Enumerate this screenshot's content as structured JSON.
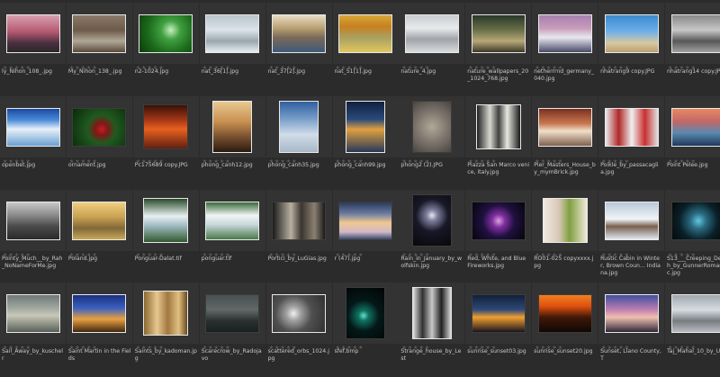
{
  "browser": {
    "star_glyph": "★★★★★",
    "items": [
      {
        "name": "ly_Nihon_108_.jpg",
        "bg": "linear-gradient(180deg,#d8a0b0 0%,#b45870 45%,#4a3040 75%,#2a2828 100%)",
        "shape": "wide",
        "dark": false
      },
      {
        "name": "My_Nihon_138_.jpg",
        "bg": "linear-gradient(180deg,#8a7a6a 0%,#6d5a48 40%,#b0a898 70%,#5a4a3a 100%)",
        "shape": "wide",
        "dark": false
      },
      {
        "name": "n2-1024.jpg",
        "bg": "radial-gradient(circle at 60% 40%,#c8f0c0 0%,#40a040 25%,#1c6a1c 60%,#0c3a0c 100%)",
        "shape": "wide",
        "dark": false
      },
      {
        "name": "nat_36[1].jpg",
        "bg": "linear-gradient(180deg,#b8c4cc 0%,#dde4ea 40%,#9aa6ae 70%,#e8eef2 100%)",
        "shape": "wide",
        "dark": false
      },
      {
        "name": "nat_37[2].jpg",
        "bg": "linear-gradient(180deg,#e8dcc4 0%,#b8a070 35%,#7a6a58 60%,#3f5a7a 100%)",
        "shape": "wide",
        "dark": false
      },
      {
        "name": "nat_51[1].jpg",
        "bg": "linear-gradient(180deg,#d8a838 0%,#c88020 30%,#a8a060 60%,#e0c860 100%)",
        "shape": "wide",
        "dark": false
      },
      {
        "name": "nature_4.jpg",
        "bg": "linear-gradient(180deg,#c8ccd0 0%,#e8eaec 35%,#a0a4a8 65%,#d8dcde 100%)",
        "shape": "wide",
        "dark": false
      },
      {
        "name": "nature_wallpapers_20_1024_768.jpg",
        "bg": "linear-gradient(180deg,#283828 0%,#6a7048 40%,#b8a878 70%,#3a3a28 100%)",
        "shape": "wide",
        "dark": false
      },
      {
        "name": "netherrrnd_germany_040.jpg",
        "bg": "linear-gradient(180deg,#a880b0 0%,#c89cb8 35%,#e8e8f0 60%,#4a4a6a 100%)",
        "shape": "wide",
        "dark": false
      },
      {
        "name": "nhatrang9 copy.JPG",
        "bg": "linear-gradient(180deg,#3a8ad0 0%,#70b0e8 45%,#d8c8a0 75%,#b8a070 100%)",
        "shape": "wide",
        "dark": false
      },
      {
        "name": "nhatrang14 copy.JPG",
        "bg": "linear-gradient(180deg,#888888 0%,#c8c8c8 40%,#585858 70%,#a0a0a0 100%)",
        "shape": "wide",
        "dark": false
      },
      {
        "name": "openbet.jpg",
        "bg": "linear-gradient(180deg,#1a4aa0 0%,#4a8ad8 30%,#e8f0f8 55%,#6aa0d0 100%)",
        "shape": "wide",
        "dark": false
      },
      {
        "name": "ornament.jpg",
        "bg": "radial-gradient(circle at 55% 55%,#c02020 0%,#801818 18%,#205a20 40%,#0a2a0a 100%)",
        "shape": "wide",
        "dark": true
      },
      {
        "name": "Pc175689 copy.JPG",
        "bg": "linear-gradient(180deg,#3a1008 0%,#a83818 35%,#e86020 55%,#602010 100%)",
        "shape": "square",
        "dark": true
      },
      {
        "name": "phong_canh12.jpg",
        "bg": "linear-gradient(180deg,#e8c890 0%,#c89050 40%,#785030 70%,#2a1a10 100%)",
        "shape": "tall",
        "dark": false
      },
      {
        "name": "phong_canh35.jpg",
        "bg": "linear-gradient(180deg,#3060a0 0%,#7aa0c8 35%,#d0dce8 65%,#a8b8c8 100%)",
        "shape": "tall",
        "dark": false
      },
      {
        "name": "phong_canh99.jpg",
        "bg": "linear-gradient(180deg,#102040 0%,#2a4a7a 35%,#e0a040 55%,#283858 100%)",
        "shape": "tall",
        "dark": false
      },
      {
        "name": "phong2 (2).JPG",
        "bg": "radial-gradient(circle at 50% 50%,#b0a898 0%,#787068 55%,#4a4440 100%)",
        "shape": "tall",
        "dark": true
      },
      {
        "name": "Piazza San Marco venice, italy.jpg",
        "bg": "linear-gradient(90deg,#202020 0%,#d8d8d0 30%,#404040 50%,#e8e8e0 70%,#1a1a1a 100%)",
        "shape": "square",
        "dark": false
      },
      {
        "name": "Pier_Masters_House_by_mymBrick.jpg",
        "bg": "linear-gradient(180deg,#7a3020 0%,#c87850 40%,#f0e0c8 60%,#806050 100%)",
        "shape": "wide",
        "dark": false
      },
      {
        "name": "Poikle_by_passacaglia.jpg",
        "bg": "linear-gradient(90deg,#e8e8e8 0%,#b02828 25%,#f0f0f0 50%,#c83030 75%,#e0e0e0 100%)",
        "shape": "wide",
        "dark": false
      },
      {
        "name": "Point Pelee.jpg",
        "bg": "linear-gradient(180deg,#e88860 0%,#c06868 35%,#5a8ab0 65%,#20385a 100%)",
        "shape": "wide",
        "dark": false
      },
      {
        "name": "Pointy_Much__by_Rah_NoNameForMe.jpg",
        "bg": "linear-gradient(180deg,#c8c8c8 0%,#8a8a8a 35%,#4a4a4a 65%,#2a2a2a 100%)",
        "shape": "wide",
        "dark": false
      },
      {
        "name": "Poland.jpg",
        "bg": "linear-gradient(180deg,#f0d080 0%,#c8a050 40%,#806838 70%,#c8a858 100%)",
        "shape": "wide",
        "dark": false
      },
      {
        "name": "Ponguar-Dalat.tif",
        "bg": "linear-gradient(180deg,#2a4a2a 0%,#e8f0f0 40%,#a8c0c8 60%,#305a30 100%)",
        "shape": "square",
        "dark": false
      },
      {
        "name": "ponguar.tif",
        "bg": "linear-gradient(180deg,#3a6a3a 0%,#f0f4f4 35%,#c8d8dc 60%,#4a7a4a 100%)",
        "shape": "wide",
        "dark": false
      },
      {
        "name": "Portici_by_LuGias.jpg",
        "bg": "linear-gradient(90deg,#1a1a1a 0%,#b8b0a0 35%,#3a3530 55%,#8a8070 80%,#1a1a1a 100%)",
        "shape": "wide",
        "dark": true
      },
      {
        "name": "r (47).jpg",
        "bg": "linear-gradient(180deg,#2a3a5a 0%,#6a7aa0 30%,#f0c890 55%,#d0b8c8 80%,#384868 100%)",
        "shape": "wide",
        "dark": true
      },
      {
        "name": "Rain_in_January_by_wolfskin.jpg",
        "bg": "radial-gradient(circle at 50% 40%,#e8e8f0 0%,#8080a0 15%,#181828 45%,#080808 100%)",
        "shape": "tall",
        "dark": true
      },
      {
        "name": "Red, White, and Blue Fireworks.jpg",
        "bg": "radial-gradient(circle at 50% 50%,#e0a0e0 0%,#8030a0 20%,#201040 50%,#05050a 100%)",
        "shape": "wide",
        "dark": true
      },
      {
        "name": "RO01-025 copyxxxx.jpg",
        "bg": "linear-gradient(90deg,#f0e8e0 0%,#d8c8b8 35%,#80a040 60%,#f0e8d8 100%)",
        "shape": "square",
        "dark": false
      },
      {
        "name": "Rustic Cabin in Winter, Brown Coun... Indiana.jpg",
        "bg": "linear-gradient(180deg,#b8c8d8 0%,#f0f4f8 45%,#786050 65%,#e0e8f0 100%)",
        "shape": "wide",
        "dark": false
      },
      {
        "name": "S13___Creeping_Death_by_GunnerRomantic.jpg",
        "bg": "radial-gradient(circle at 50% 50%,#60c8e0 0%,#2a6a80 25%,#0a2028 60%,#050808 100%)",
        "shape": "wide",
        "dark": true
      },
      {
        "name": "Sail_Away_by_kuschelr",
        "bg": "linear-gradient(180deg,#707878 0%,#a0a8a0 35%,#c8c8b8 55%,#586058 100%)",
        "shape": "wide",
        "dark": false
      },
      {
        "name": "Saint Martin in the Fields",
        "bg": "linear-gradient(180deg,#1a3080 0%,#3a60c0 35%,#e8a040 65%,#402810 100%)",
        "shape": "wide",
        "dark": false
      },
      {
        "name": "Saints_by_kadoman.jpg",
        "bg": "linear-gradient(90deg,#8a6830 0%,#e8c890 30%,#a07840 55%,#e0c080 80%,#6a4a20 100%)",
        "shape": "square",
        "dark": false
      },
      {
        "name": "Scarecrow_by_Radojavo",
        "bg": "linear-gradient(180deg,#485050 0%,#606868 40%,#2a3030 70%,#182020 100%)",
        "shape": "wide",
        "dark": true
      },
      {
        "name": "scattered_orbs_1024.jpg",
        "bg": "radial-gradient(circle at 40% 50%,#f0f0f0 0%,#a0a0a0 20%,#505050 50%,#303030 100%)",
        "shape": "wide",
        "dark": false
      },
      {
        "name": "sfef.bmp",
        "bg": "radial-gradient(circle at 45% 55%,#60e0d0 0%,#107060 15%,#041818 45%,#020404 100%)",
        "shape": "tall",
        "dark": true
      },
      {
        "name": "Strange_house_by_Lest",
        "bg": "linear-gradient(90deg,#e0e0e0 0%,#303030 25%,#c8c8c8 50%,#202020 75%,#d8d8d8 100%)",
        "shape": "tall",
        "dark": false
      },
      {
        "name": "sunrise_sunset03.jpg",
        "bg": "linear-gradient(180deg,#10203a 0%,#304a78 40%,#f0a030 60%,#1a1420 100%)",
        "shape": "wide",
        "dark": true
      },
      {
        "name": "sunrise_sunset20.jpg",
        "bg": "linear-gradient(180deg,#f08020 0%,#e05010 30%,#401808 60%,#100804 100%)",
        "shape": "wide",
        "dark": true
      },
      {
        "name": "Sunset, Llano County, T",
        "bg": "linear-gradient(180deg,#4050a0 0%,#c080b0 40%,#f0c0b0 60%,#302838 100%)",
        "shape": "wide",
        "dark": false
      },
      {
        "name": "Taj_Mahal_10_by_UG3",
        "bg": "linear-gradient(180deg,#a0a8b0 0%,#d8dce0 40%,#787c80 70%,#b8bcc0 100%)",
        "shape": "wide",
        "dark": false
      }
    ]
  }
}
